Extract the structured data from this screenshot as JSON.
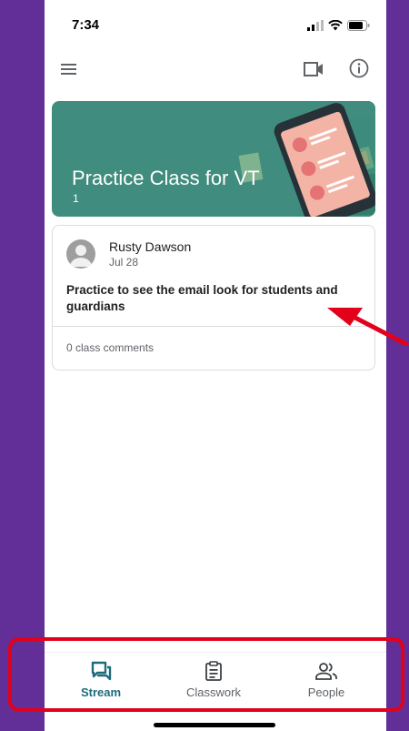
{
  "status_bar": {
    "time": "7:34"
  },
  "class": {
    "name": "Practice Class for VT",
    "section": "1",
    "banner_color": "#408c7e"
  },
  "post": {
    "author": "Rusty Dawson",
    "date": "Jul 28",
    "text": "Practice to see the email look for students and guardians",
    "comments": "0 class comments"
  },
  "bottom_nav": {
    "items": [
      {
        "label": "Stream",
        "icon": "stream-icon",
        "active": true
      },
      {
        "label": "Classwork",
        "icon": "classwork-icon",
        "active": false
      },
      {
        "label": "People",
        "icon": "people-icon",
        "active": false
      }
    ],
    "active_color": "#1e6b7b"
  },
  "annotations": {
    "color": "#e3001b"
  }
}
